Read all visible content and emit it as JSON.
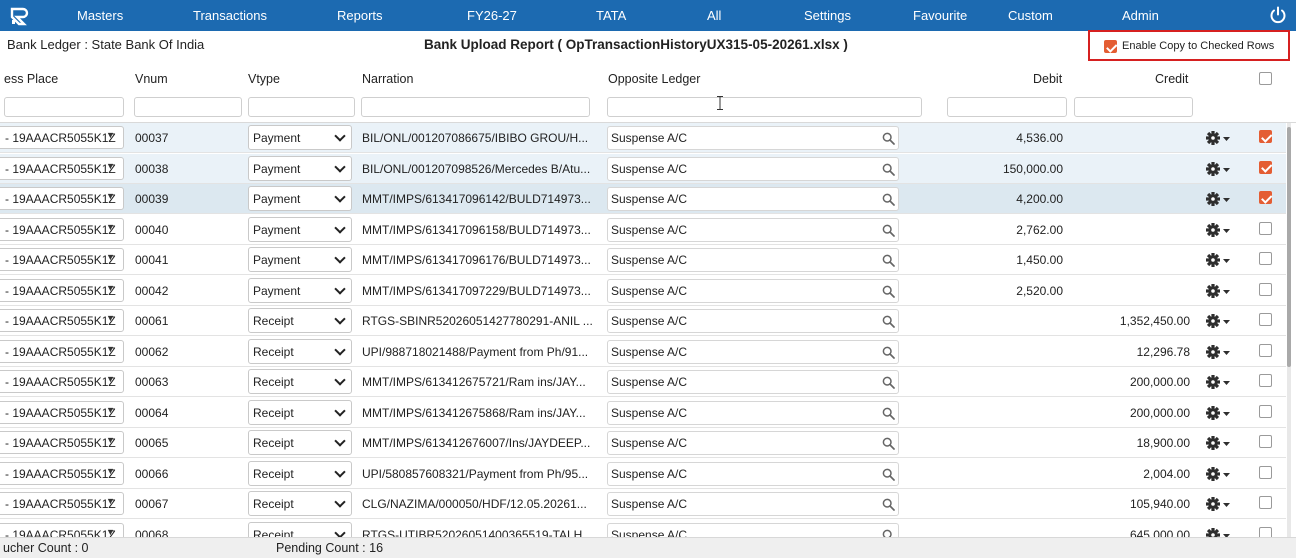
{
  "nav": {
    "items": [
      "Masters",
      "Transactions",
      "Reports",
      "FY26-27",
      "TATA",
      "All",
      "Settings",
      "Favourite",
      "Custom",
      "Admin"
    ]
  },
  "header": {
    "ledger_title": "Bank Ledger : State Bank Of India",
    "report_title": "Bank Upload Report ( OpTransactionHistoryUX315-05-20261.xlsx )",
    "copy_label": "Enable Copy to Checked Rows",
    "copy_checked": true
  },
  "columns": {
    "place": "ess Place",
    "vnum": "Vnum",
    "vtype": "Vtype",
    "narration": "Narration",
    "opposite": "Opposite Ledger",
    "debit": "Debit",
    "credit": "Credit"
  },
  "rows": [
    {
      "place": "- 19AAACR5055K1Z",
      "vnum": "00037",
      "vtype": "Payment",
      "narration": "BIL/ONL/001207086675/IBIBO GROU/H...",
      "opposite": "Suspense A/C",
      "debit": "4,536.00",
      "credit": "",
      "checked": true
    },
    {
      "place": "- 19AAACR5055K1Z",
      "vnum": "00038",
      "vtype": "Payment",
      "narration": "BIL/ONL/001207098526/Mercedes B/Atu...",
      "opposite": "Suspense A/C",
      "debit": "150,000.00",
      "credit": "",
      "checked": true
    },
    {
      "place": "- 19AAACR5055K1Z",
      "vnum": "00039",
      "vtype": "Payment",
      "narration": "MMT/IMPS/613417096142/BULD714973...",
      "opposite": "Suspense A/C",
      "debit": "4,200.00",
      "credit": "",
      "checked": true
    },
    {
      "place": "- 19AAACR5055K1Z",
      "vnum": "00040",
      "vtype": "Payment",
      "narration": "MMT/IMPS/613417096158/BULD714973...",
      "opposite": "Suspense A/C",
      "debit": "2,762.00",
      "credit": "",
      "checked": false
    },
    {
      "place": "- 19AAACR5055K1Z",
      "vnum": "00041",
      "vtype": "Payment",
      "narration": "MMT/IMPS/613417096176/BULD714973...",
      "opposite": "Suspense A/C",
      "debit": "1,450.00",
      "credit": "",
      "checked": false
    },
    {
      "place": "- 19AAACR5055K1Z",
      "vnum": "00042",
      "vtype": "Payment",
      "narration": "MMT/IMPS/613417097229/BULD714973...",
      "opposite": "Suspense A/C",
      "debit": "2,520.00",
      "credit": "",
      "checked": false
    },
    {
      "place": "- 19AAACR5055K1Z",
      "vnum": "00061",
      "vtype": "Receipt",
      "narration": "RTGS-SBINR52026051427780291-ANIL ...",
      "opposite": "Suspense A/C",
      "debit": "",
      "credit": "1,352,450.00",
      "checked": false
    },
    {
      "place": "- 19AAACR5055K1Z",
      "vnum": "00062",
      "vtype": "Receipt",
      "narration": "UPI/988718021488/Payment from Ph/91...",
      "opposite": "Suspense A/C",
      "debit": "",
      "credit": "12,296.78",
      "checked": false
    },
    {
      "place": "- 19AAACR5055K1Z",
      "vnum": "00063",
      "vtype": "Receipt",
      "narration": "MMT/IMPS/613412675721/Ram ins/JAY...",
      "opposite": "Suspense A/C",
      "debit": "",
      "credit": "200,000.00",
      "checked": false
    },
    {
      "place": "- 19AAACR5055K1Z",
      "vnum": "00064",
      "vtype": "Receipt",
      "narration": "MMT/IMPS/613412675868/Ram ins/JAY...",
      "opposite": "Suspense A/C",
      "debit": "",
      "credit": "200,000.00",
      "checked": false
    },
    {
      "place": "- 19AAACR5055K1Z",
      "vnum": "00065",
      "vtype": "Receipt",
      "narration": "MMT/IMPS/613412676007/Ins/JAYDEEP...",
      "opposite": "Suspense A/C",
      "debit": "",
      "credit": "18,900.00",
      "checked": false
    },
    {
      "place": "- 19AAACR5055K1Z",
      "vnum": "00066",
      "vtype": "Receipt",
      "narration": "UPI/580857608321/Payment from Ph/95...",
      "opposite": "Suspense A/C",
      "debit": "",
      "credit": "2,004.00",
      "checked": false
    },
    {
      "place": "- 19AAACR5055K1Z",
      "vnum": "00067",
      "vtype": "Receipt",
      "narration": "CLG/NAZIMA/000050/HDF/12.05.20261...",
      "opposite": "Suspense A/C",
      "debit": "",
      "credit": "105,940.00",
      "checked": false
    },
    {
      "place": "- 19AAACR5055K1Z",
      "vnum": "00068",
      "vtype": "Receipt",
      "narration": "RTGS-UTIBR52026051400365519-TALH...",
      "opposite": "Suspense A/C",
      "debit": "",
      "credit": "645,000.00",
      "checked": false
    }
  ],
  "footer": {
    "voucher_count": "ucher Count : 0",
    "pending_count": "Pending Count : 16"
  }
}
